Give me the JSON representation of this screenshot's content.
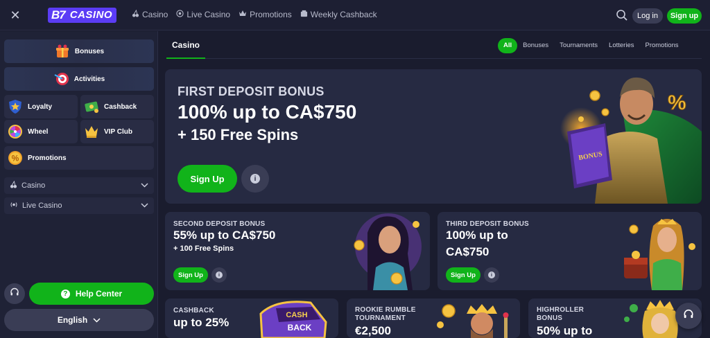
{
  "header": {
    "logo_mark": "B7",
    "logo_word": "CASINO",
    "nav": [
      {
        "label": "Casino",
        "icon": "cherries-icon"
      },
      {
        "label": "Live Casino",
        "icon": "live-icon"
      },
      {
        "label": "Promotions",
        "icon": "crown-icon"
      },
      {
        "label": "Weekly Cashback",
        "icon": "cashback-icon"
      }
    ],
    "login_label": "Log in",
    "signup_label": "Sign up"
  },
  "sidebar": {
    "bonuses_label": "Bonuses",
    "activities_label": "Activities",
    "loyalty_label": "Loyalty",
    "cashback_label": "Cashback",
    "wheel_label": "Wheel",
    "vip_label": "VIP Club",
    "promotions_label": "Promotions",
    "casino_dropdown": "Casino",
    "live_casino_dropdown": "Live Casino",
    "help_label": "Help Center",
    "language_label": "English"
  },
  "main": {
    "section_tab": "Casino",
    "filters": [
      "All",
      "Bonuses",
      "Tournaments",
      "Lotteries",
      "Promotions"
    ],
    "active_filter": "All",
    "hero": {
      "label": "FIRST DEPOSIT BONUS",
      "title": "100% up to CA$750",
      "subtitle": "+ 150 Free Spins",
      "signup_label": "Sign Up",
      "book_text": "BONUS"
    },
    "cards": [
      {
        "label": "SECOND DEPOSIT BONUS",
        "title": "55% up to CA$750",
        "sub": "+ 100 Free Spins",
        "signup": "Sign Up"
      },
      {
        "label": "THIRD DEPOSIT BONUS",
        "title_line1": "100% up to",
        "title_line2": "CA$750",
        "signup": "Sign Up"
      },
      {
        "label": "CASHBACK",
        "title": "up to 25%",
        "art_text_1": "CASH",
        "art_text_2": "BACK"
      },
      {
        "label_line1": "ROOKIE RUMBLE",
        "label_line2": "TOURNAMENT",
        "title": "€2,500"
      },
      {
        "label_line1": "HIGHROLLER",
        "label_line2": "BONUS",
        "title": "50% up to"
      }
    ]
  },
  "colors": {
    "background": "#1a1c2e",
    "panel": "#262a42",
    "accent_green": "#11b31a",
    "brand_purple": "#5b3cf5"
  }
}
